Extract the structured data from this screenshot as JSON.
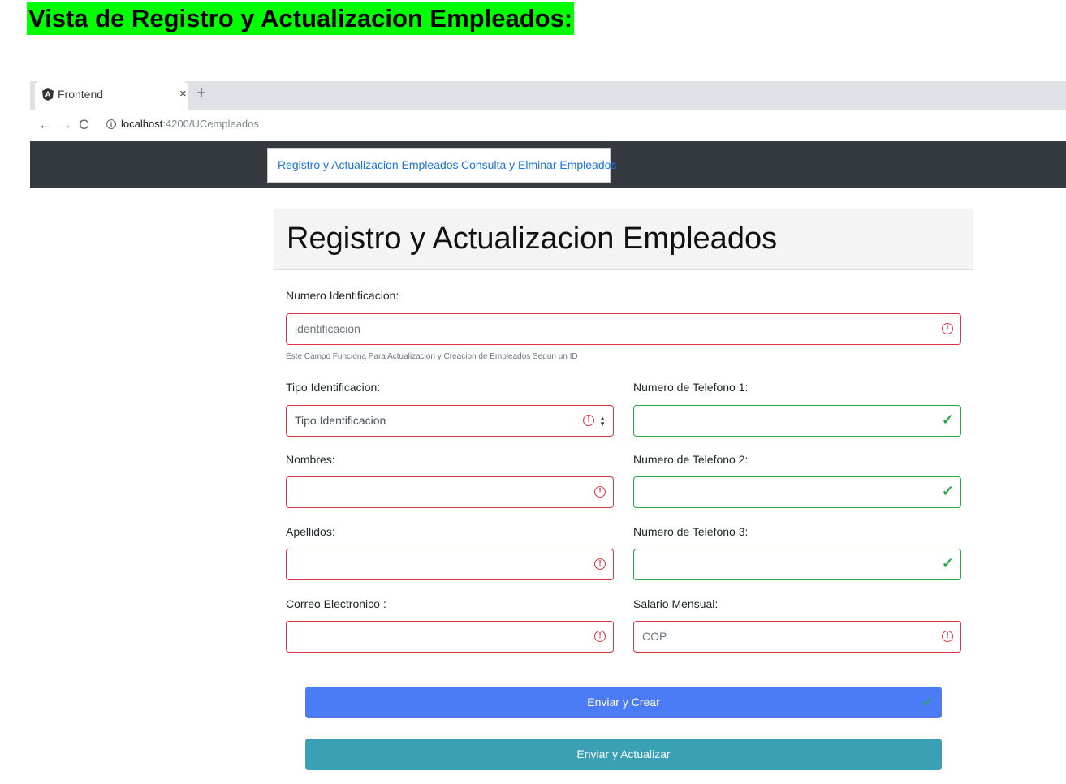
{
  "doc_heading": "Vista de Registro y Actualizacion Empleados:",
  "browser": {
    "tab_title": "Frontend",
    "tab_close": "×",
    "new_tab": "+",
    "url_host": "localhost",
    "url_path": ":4200/UCempleados"
  },
  "navbar": {
    "registro_link": "Registro y Actualizacion Empleados",
    "consulta_link": "Consulta y Elminar Empleados"
  },
  "page_title": "Registro y Actualizacion Empleados",
  "form": {
    "numero_identificacion": {
      "label": "Numero Identificacion:",
      "placeholder": "identificacion",
      "help": "Este Campo Funciona Para Actualizacion y Creacion de Empleados Segun un ID",
      "state": "invalid"
    },
    "tipo_identificacion": {
      "label": "Tipo Identificacion:",
      "selected": "Tipo Identificacion",
      "state": "invalid"
    },
    "nombres": {
      "label": "Nombres:",
      "value": "",
      "state": "invalid"
    },
    "apellidos": {
      "label": "Apellidos:",
      "value": "",
      "state": "invalid"
    },
    "correo": {
      "label": "Correo Electronico :",
      "value": "",
      "state": "invalid"
    },
    "telefono1": {
      "label": "Numero de Telefono 1:",
      "value": "",
      "state": "valid"
    },
    "telefono2": {
      "label": "Numero de Telefono 2:",
      "value": "",
      "state": "valid"
    },
    "telefono3": {
      "label": "Numero de Telefono 3:",
      "value": "",
      "state": "valid"
    },
    "salario": {
      "label": "Salario Mensual:",
      "placeholder": "COP",
      "state": "invalid"
    }
  },
  "buttons": {
    "crear": "Enviar y Crear",
    "actualizar": "Enviar y Actualizar"
  },
  "colors": {
    "heading_highlight": "#00ff00",
    "navbar_bg": "#343a40",
    "invalid": "#dc3545",
    "valid": "#28a745",
    "btn_crear": "#4b7bf5",
    "btn_actualizar": "#3aa0b4"
  }
}
